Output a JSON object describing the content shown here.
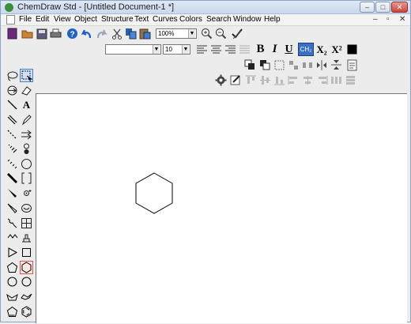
{
  "window": {
    "title": "ChemDraw Std - [Untitled Document-1 *]",
    "minimize": "–",
    "restore": "□",
    "close": "✕",
    "colors": {
      "accent": "#c8453b",
      "title_bg": "#cfdcee"
    }
  },
  "menubar": {
    "items": [
      "File",
      "Edit",
      "View",
      "Object",
      "Structure",
      "Text",
      "Curves",
      "Colors",
      "Search",
      "Window",
      "Help"
    ],
    "doc_controls": [
      "–",
      "▫",
      "✕"
    ]
  },
  "toolbar": {
    "zoom_value": "100%",
    "font_value": "",
    "size_value": "10",
    "bold": "B",
    "italic": "I",
    "underline": "U",
    "chem_style": "CH₂",
    "subscript": "X₂",
    "superscript": "X²"
  },
  "palette": {
    "text_tool": "A"
  }
}
